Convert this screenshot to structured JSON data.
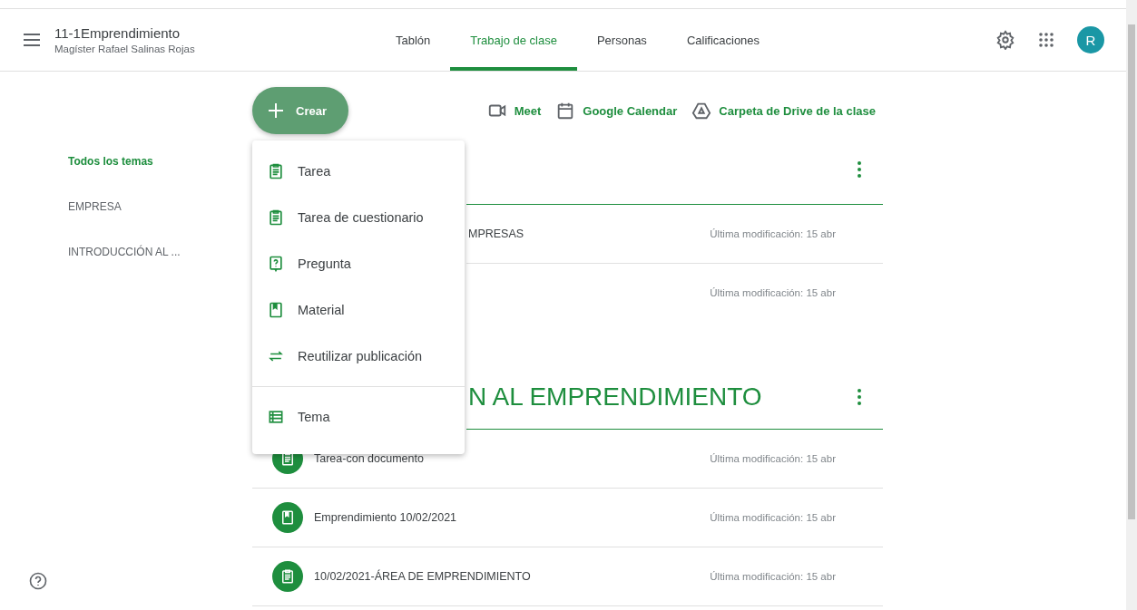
{
  "header": {
    "class_name": "11-1Emprendimiento",
    "teacher": "Magíster Rafael Salinas Rojas",
    "avatar_letter": "R"
  },
  "tabs": [
    {
      "label": "Tablón",
      "selected": false
    },
    {
      "label": "Trabajo de clase",
      "selected": true
    },
    {
      "label": "Personas",
      "selected": false
    },
    {
      "label": "Calificaciones",
      "selected": false
    }
  ],
  "topics": [
    {
      "label": "Todos los temas",
      "selected": true
    },
    {
      "label": "EMPRESA",
      "selected": false
    },
    {
      "label": "INTRODUCCIÓN AL ...",
      "selected": false
    }
  ],
  "create_button": {
    "label": "Crear"
  },
  "links": [
    {
      "kind": "video",
      "label": "Meet"
    },
    {
      "kind": "calendar",
      "label": "Google Calendar"
    },
    {
      "kind": "drive",
      "label": "Carpeta de Drive de la clase"
    }
  ],
  "create_menu": [
    {
      "kind": "assignment",
      "label": "Tarea",
      "divider_before": false
    },
    {
      "kind": "assignment",
      "label": "Tarea de cuestionario",
      "divider_before": false
    },
    {
      "kind": "question",
      "label": "Pregunta",
      "divider_before": false
    },
    {
      "kind": "material",
      "label": "Material",
      "divider_before": false
    },
    {
      "kind": "reuse",
      "label": "Reutilizar publicación",
      "divider_before": false
    },
    {
      "kind": "topic",
      "label": "Tema",
      "divider_before": true
    }
  ],
  "sections": [
    {
      "items": [
        {
          "title": "MPRESAS",
          "meta": "Última modificación: 15 abr"
        },
        {
          "meta": "Última modificación: 15 abr"
        }
      ]
    },
    {
      "title": "N AL EMPRENDIMIENTO",
      "items": [
        {
          "kind": "assignment",
          "title": "Tarea-con documento",
          "meta": "Última modificación: 15 abr"
        },
        {
          "kind": "material",
          "title": "Emprendimiento 10/02/2021",
          "meta": "Última modificación: 15 abr"
        },
        {
          "kind": "assignment",
          "title": "10/02/2021-ÁREA DE EMPRENDIMIENTO",
          "meta": "Última modificación: 15 abr"
        }
      ]
    }
  ]
}
